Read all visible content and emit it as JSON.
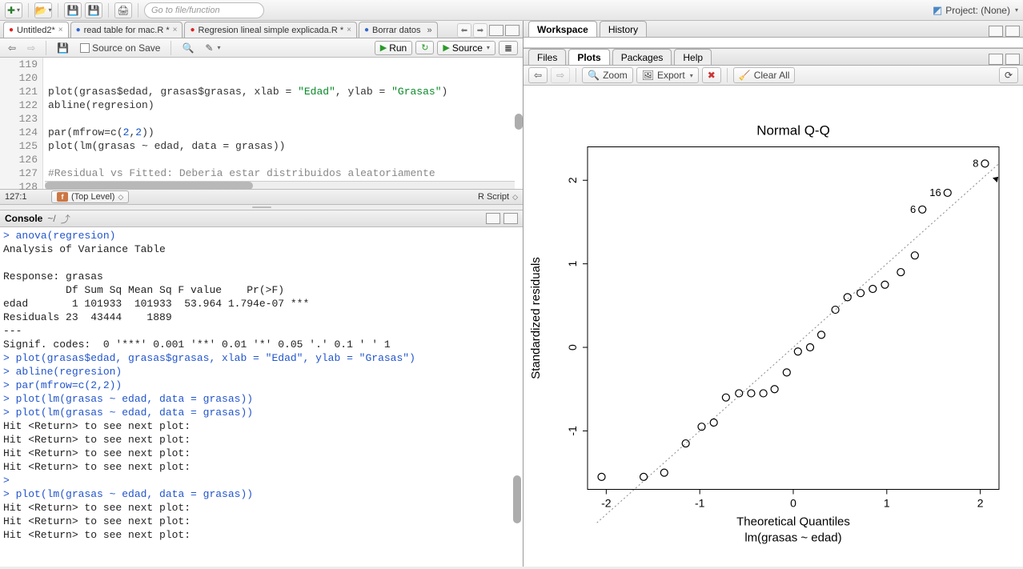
{
  "toolbar": {
    "goto_placeholder": "Go to file/function",
    "project_label": "Project: (None)"
  },
  "source_tabs": {
    "items": [
      {
        "label": "Untitled2*",
        "active": true
      },
      {
        "label": "read table for mac.R *",
        "active": false
      },
      {
        "label": "Regresion lineal simple explicada.R *",
        "active": false
      },
      {
        "label": "Borrar datos",
        "active": false
      }
    ],
    "overflow": "»"
  },
  "source_toolbar": {
    "source_on_save": "Source on Save",
    "run": "Run",
    "source": "Source"
  },
  "editor": {
    "start_line": 119,
    "lines": [
      "",
      "",
      "plot(grasas$edad, grasas$grasas, xlab = \"Edad\", ylab = \"Grasas\")",
      "abline(regresion)",
      "",
      "par(mfrow=c(2,2))",
      "plot(lm(grasas ~ edad, data = grasas))",
      "",
      "#Residual vs Fitted: Deberia estar distribuidos aleatoriamente",
      ""
    ]
  },
  "source_status": {
    "cursor": "127:1",
    "scope": "(Top Level)",
    "lang": "R Script"
  },
  "console": {
    "title": "Console",
    "path": "~/",
    "lines": [
      {
        "t": "cmd",
        "s": "anova(regresion)"
      },
      {
        "t": "out",
        "s": "Analysis of Variance Table"
      },
      {
        "t": "out",
        "s": ""
      },
      {
        "t": "out",
        "s": "Response: grasas"
      },
      {
        "t": "out",
        "s": "          Df Sum Sq Mean Sq F value    Pr(>F)    "
      },
      {
        "t": "out",
        "s": "edad       1 101933  101933  53.964 1.794e-07 ***"
      },
      {
        "t": "out",
        "s": "Residuals 23  43444    1889                      "
      },
      {
        "t": "out",
        "s": "---"
      },
      {
        "t": "out",
        "s": "Signif. codes:  0 '***' 0.001 '**' 0.01 '*' 0.05 '.' 0.1 ' ' 1"
      },
      {
        "t": "cmd",
        "s": "plot(grasas$edad, grasas$grasas, xlab = \"Edad\", ylab = \"Grasas\")"
      },
      {
        "t": "cmd",
        "s": "abline(regresion)"
      },
      {
        "t": "cmd",
        "s": "par(mfrow=c(2,2))"
      },
      {
        "t": "cmd",
        "s": "plot(lm(grasas ~ edad, data = grasas))"
      },
      {
        "t": "cmd",
        "s": "plot(lm(grasas ~ edad, data = grasas))"
      },
      {
        "t": "out",
        "s": "Hit <Return> to see next plot: "
      },
      {
        "t": "out",
        "s": "Hit <Return> to see next plot: "
      },
      {
        "t": "out",
        "s": "Hit <Return> to see next plot: "
      },
      {
        "t": "out",
        "s": "Hit <Return> to see next plot: "
      },
      {
        "t": "cmd",
        "s": ""
      },
      {
        "t": "cmd",
        "s": "plot(lm(grasas ~ edad, data = grasas))"
      },
      {
        "t": "out",
        "s": "Hit <Return> to see next plot: "
      },
      {
        "t": "out",
        "s": "Hit <Return> to see next plot: "
      },
      {
        "t": "out",
        "s": "Hit <Return> to see next plot: "
      }
    ]
  },
  "workspace_tabs": {
    "items": [
      "Workspace",
      "History"
    ],
    "active": 0
  },
  "plots_tabs": {
    "items": [
      "Files",
      "Plots",
      "Packages",
      "Help"
    ],
    "active": 1
  },
  "plot_toolbar": {
    "zoom": "Zoom",
    "export": "Export",
    "clear": "Clear All"
  },
  "chart_data": {
    "type": "scatter",
    "title": "Normal Q-Q",
    "xlabel": "Theoretical Quantiles",
    "subtitle": "lm(grasas ~ edad)",
    "ylabel": "Standardized residuals",
    "xlim": [
      -2.2,
      2.2
    ],
    "ylim": [
      -1.7,
      2.4
    ],
    "x_ticks": [
      -2,
      -1,
      0,
      1,
      2
    ],
    "y_ticks": [
      -1,
      0,
      1,
      2
    ],
    "ref_line": {
      "x1": -2.1,
      "y1": -2.1,
      "x2": 2.2,
      "y2": 2.2,
      "style": "dotted"
    },
    "labeled_points": [
      {
        "x": 2.05,
        "y": 2.2,
        "label": "8"
      },
      {
        "x": 1.65,
        "y": 1.85,
        "label": "16"
      },
      {
        "x": 1.38,
        "y": 1.65,
        "label": "6"
      }
    ],
    "points": [
      {
        "x": -2.05,
        "y": -1.55
      },
      {
        "x": -1.6,
        "y": -1.55
      },
      {
        "x": -1.38,
        "y": -1.5
      },
      {
        "x": -1.15,
        "y": -1.15
      },
      {
        "x": -0.98,
        "y": -0.95
      },
      {
        "x": -0.85,
        "y": -0.9
      },
      {
        "x": -0.72,
        "y": -0.6
      },
      {
        "x": -0.58,
        "y": -0.55
      },
      {
        "x": -0.45,
        "y": -0.55
      },
      {
        "x": -0.32,
        "y": -0.55
      },
      {
        "x": -0.2,
        "y": -0.5
      },
      {
        "x": -0.07,
        "y": -0.3
      },
      {
        "x": 0.05,
        "y": -0.05
      },
      {
        "x": 0.18,
        "y": 0.0
      },
      {
        "x": 0.3,
        "y": 0.15
      },
      {
        "x": 0.45,
        "y": 0.45
      },
      {
        "x": 0.58,
        "y": 0.6
      },
      {
        "x": 0.72,
        "y": 0.65
      },
      {
        "x": 0.85,
        "y": 0.7
      },
      {
        "x": 0.98,
        "y": 0.75
      },
      {
        "x": 1.15,
        "y": 0.9
      },
      {
        "x": 1.3,
        "y": 1.1
      }
    ]
  }
}
